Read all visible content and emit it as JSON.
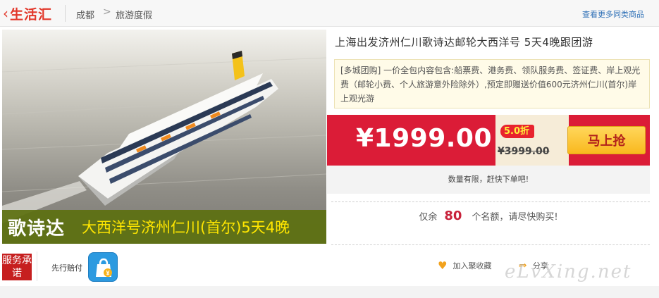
{
  "header": {
    "brand": "生活汇",
    "brand_arrow": "‹",
    "breadcrumb": [
      "成都",
      "旅游度假"
    ],
    "breadcrumb_separator": ">",
    "more_link": "查看更多同类商品"
  },
  "hero": {
    "caption_main": "歌诗达",
    "caption_sub": "大西洋号济州仁川(首尔)5天4晚"
  },
  "product": {
    "title": "上海出发济州仁川歌诗达邮轮大西洋号 5天4晚跟团游",
    "promo": "[多城团购] 一价全包内容包含:船票费、港务费、领队服务费、签证费、岸上观光费（邮轮小费、个人旅游意外险除外）,预定即赠送价值600元济州仁川(首尔)岸上观光游"
  },
  "pricing": {
    "price": "¥1999.00",
    "discount": "5.0折",
    "original_price": "¥3999.00",
    "buy_button": "马上抢",
    "limited_notice": "数量有限，赶快下单吧!",
    "remaining_prefix": "仅余",
    "remaining_count": "80",
    "remaining_suffix": "个名额，请尽快购买!"
  },
  "service": {
    "badge": "服务承诺",
    "label": "先行赔付",
    "icon": "shopping-bag-icon"
  },
  "actions": {
    "favorite": "加入聚收藏",
    "share": "分享"
  },
  "watermark": "eLvXing.net",
  "colors": {
    "accent_red": "#db1c37",
    "brand_red": "#e2372a",
    "buy_button": "#f9b81e",
    "caption_bar": "#5c700f",
    "caption_text": "#ffe600"
  }
}
